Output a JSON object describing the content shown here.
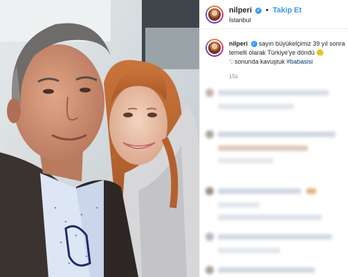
{
  "post": {
    "username": "nilperi",
    "verified_mark": "✓",
    "separator": "•",
    "follow_label": "Takip Et",
    "location": "İstanbul"
  },
  "caption": {
    "username": "nilperi",
    "verified_mark": "✓",
    "text": " sayın büyükelçimiz 39 yıl sonra temelli olarak Türkiye'ye döndü 🙃♡sonunda kavuştuk ",
    "hashtag": "#babasisi",
    "time": "15s"
  },
  "icons": {
    "verified": "verified-badge-icon",
    "avatar": "profile-avatar"
  },
  "colors": {
    "accent": "#3897f0",
    "hashtag": "#00376b",
    "muted": "#8e8e8e"
  }
}
